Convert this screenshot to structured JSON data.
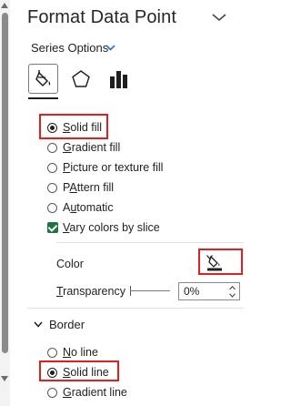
{
  "pane": {
    "title": "Format Data Point",
    "series_options_label": "Series Options"
  },
  "tabs": [
    {
      "icon": "paint-bucket-icon",
      "active": true
    },
    {
      "icon": "pentagon-effects-icon",
      "active": false
    },
    {
      "icon": "bar-size-icon",
      "active": false
    }
  ],
  "fill": {
    "options": [
      {
        "label": "Solid fill",
        "accel": "S",
        "rest": "olid fill",
        "checked": true
      },
      {
        "label": "Gradient fill",
        "accel": "G",
        "rest": "radient fill",
        "checked": false
      },
      {
        "label": "Picture or texture fill",
        "accel": "P",
        "rest": "icture or texture fill",
        "checked": false
      },
      {
        "label": "Pattern fill",
        "accel": "A",
        "pre": "P",
        "rest": "ttern fill",
        "checked": false
      },
      {
        "label": "Automatic",
        "accel": "u",
        "pre": "A",
        "rest": "tomatic",
        "checked": false
      }
    ],
    "vary_colors": {
      "pre": "",
      "accel": "V",
      "rest": "ary colors by slice",
      "checked": true
    },
    "color_label": "Color",
    "transparency_label": {
      "accel": "T",
      "rest": "ransparency"
    },
    "transparency_value": "0%",
    "fill_swatch_color": "#1f1f1f"
  },
  "border": {
    "heading": "Border",
    "options": [
      {
        "accel": "N",
        "rest": "o line",
        "checked": false
      },
      {
        "accel": "S",
        "rest": "olid line",
        "checked": true
      },
      {
        "accel": "G",
        "rest": "radient line",
        "checked": false
      }
    ]
  },
  "colors": {
    "highlight": "#e02020",
    "checkbox": "#217346",
    "accent_chevron": "#2b6fd6"
  }
}
